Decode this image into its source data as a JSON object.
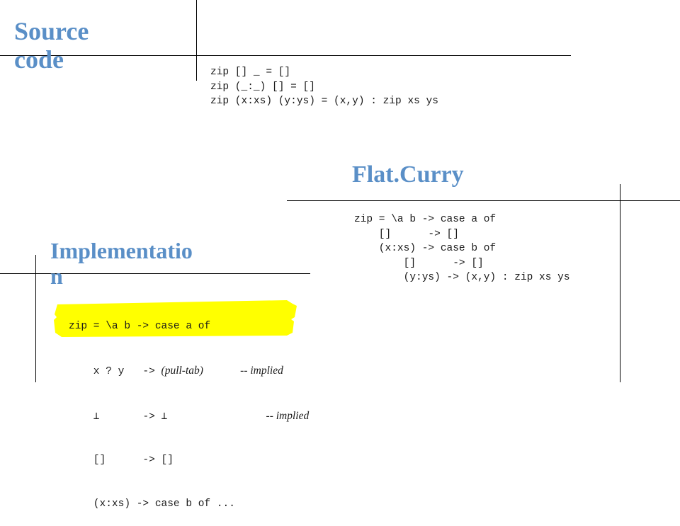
{
  "slide": {
    "background_color": "#ffffff",
    "heading_color": "#5a8fc7",
    "rule_color": "#000000",
    "highlight_color": "#ffff00"
  },
  "headings": {
    "source": "Source\ncode",
    "flatcurry": "Flat.Curry",
    "implementation": "Implementatio\nn"
  },
  "code_blocks": {
    "source": "zip [] _ = []\nzip (_:_) [] = []\nzip (x:xs) (y:ys) = (x,y) : zip xs ys",
    "flatcurry": "zip = \\a b -> case a of\n    []      -> []\n    (x:xs) -> case b of\n        []      -> []\n        (y:ys) -> (x,y) : zip xs ys",
    "implementation": {
      "line1": "zip = \\a b -> case a of",
      "line2_pattern": "    x ? y  ",
      "line2_arrow": " -> ",
      "line2_body": "(pull-tab)",
      "line2_gap": "      ",
      "line2_comment": "-- implied",
      "line3_pattern": "    ⊥      ",
      "line3_arrow": " -> ",
      "line3_body": "⊥",
      "line3_gap": "                ",
      "line3_comment": "-- implied",
      "line4": "    []      -> []",
      "line5": "    (x:xs) -> case b of ..."
    }
  }
}
